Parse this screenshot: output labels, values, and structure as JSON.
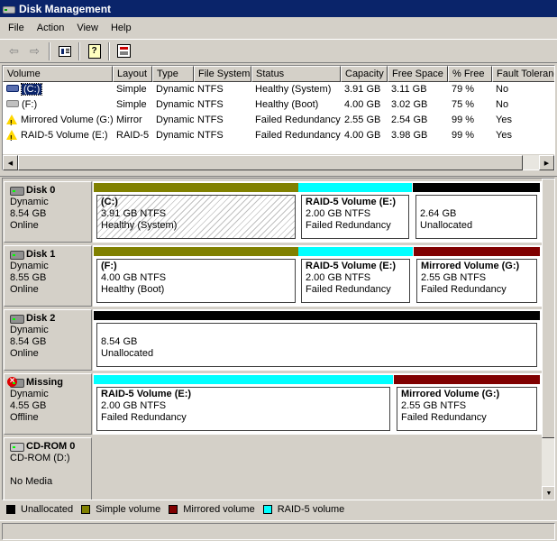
{
  "window": {
    "title": "Disk Management"
  },
  "menu": [
    "File",
    "Action",
    "View",
    "Help"
  ],
  "toolbar": {
    "back_icon": "back-arrow-icon",
    "forward_icon": "forward-arrow-icon",
    "properties_icon": "properties-icon",
    "help_icon": "help-icon",
    "help_glyph": "?",
    "settings_icon": "settings-icon"
  },
  "volume_list": {
    "columns": [
      "Volume",
      "Layout",
      "Type",
      "File System",
      "Status",
      "Capacity",
      "Free Space",
      "% Free",
      "Fault Tolerance"
    ],
    "rows": [
      {
        "icon": "system-volume-icon",
        "volume": "(C:)",
        "layout": "Simple",
        "type": "Dynamic",
        "fs": "NTFS",
        "status": "Healthy (System)",
        "capacity": "3.91 GB",
        "free": "3.11 GB",
        "pct": "79 %",
        "fault": "No"
      },
      {
        "icon": "volume-icon",
        "volume": "(F:)",
        "layout": "Simple",
        "type": "Dynamic",
        "fs": "NTFS",
        "status": "Healthy (Boot)",
        "capacity": "4.00 GB",
        "free": "3.02 GB",
        "pct": "75 %",
        "fault": "No"
      },
      {
        "icon": "warning-icon",
        "volume": "Mirrored Volume (G:)",
        "layout": "Mirror",
        "type": "Dynamic",
        "fs": "NTFS",
        "status": "Failed Redundancy",
        "capacity": "2.55 GB",
        "free": "2.54 GB",
        "pct": "99 %",
        "fault": "Yes"
      },
      {
        "icon": "warning-icon",
        "volume": "RAID-5 Volume (E:)",
        "layout": "RAID-5",
        "type": "Dynamic",
        "fs": "NTFS",
        "status": "Failed Redundancy",
        "capacity": "4.00 GB",
        "free": "3.98 GB",
        "pct": "99 %",
        "fault": "Yes"
      }
    ]
  },
  "disks": [
    {
      "name": "Disk 0",
      "type": "Dynamic",
      "size": "8.54 GB",
      "state": "Online",
      "partitions": [
        {
          "title": "(C:)",
          "line2": "3.91 GB NTFS",
          "line3": "Healthy (System)",
          "kind": "simple"
        },
        {
          "title": "RAID-5 Volume  (E:)",
          "line2": "2.00 GB NTFS",
          "line3": "Failed Redundancy",
          "kind": "raid5"
        },
        {
          "title": "",
          "line2": "2.64 GB",
          "line3": "Unallocated",
          "kind": "unallocated"
        }
      ]
    },
    {
      "name": "Disk 1",
      "type": "Dynamic",
      "size": "8.55 GB",
      "state": "Online",
      "partitions": [
        {
          "title": "(F:)",
          "line2": "4.00 GB NTFS",
          "line3": "Healthy (Boot)",
          "kind": "simple"
        },
        {
          "title": "RAID-5 Volume  (E:)",
          "line2": "2.00 GB NTFS",
          "line3": "Failed Redundancy",
          "kind": "raid5"
        },
        {
          "title": "Mirrored Volume  (G:)",
          "line2": "2.55 GB NTFS",
          "line3": "Failed Redundancy",
          "kind": "mirror"
        }
      ]
    },
    {
      "name": "Disk 2",
      "type": "Dynamic",
      "size": "8.54 GB",
      "state": "Online",
      "partitions": [
        {
          "title": "",
          "line2": "8.54 GB",
          "line3": "Unallocated",
          "kind": "unallocated"
        }
      ]
    },
    {
      "name": "Missing",
      "type": "Dynamic",
      "size": "4.55 GB",
      "state": "Offline",
      "partitions": [
        {
          "title": "RAID-5 Volume  (E:)",
          "line2": "2.00 GB NTFS",
          "line3": "Failed Redundancy",
          "kind": "raid5"
        },
        {
          "title": "Mirrored Volume  (G:)",
          "line2": "2.55 GB NTFS",
          "line3": "Failed Redundancy",
          "kind": "mirror"
        }
      ]
    },
    {
      "name": "CD-ROM 0",
      "type": "CD-ROM (D:)",
      "size": "",
      "state": "No Media",
      "partitions": []
    }
  ],
  "legend": [
    {
      "label": "Unallocated",
      "color": "#000000"
    },
    {
      "label": "Simple volume",
      "color": "#808000"
    },
    {
      "label": "Mirrored volume",
      "color": "#800000"
    },
    {
      "label": "RAID-5 volume",
      "color": "#00ffff"
    }
  ],
  "colors": {
    "selection": "#0a246a",
    "unallocated": "#000000",
    "simple": "#808000",
    "mirror": "#800000",
    "raid5": "#00ffff"
  }
}
